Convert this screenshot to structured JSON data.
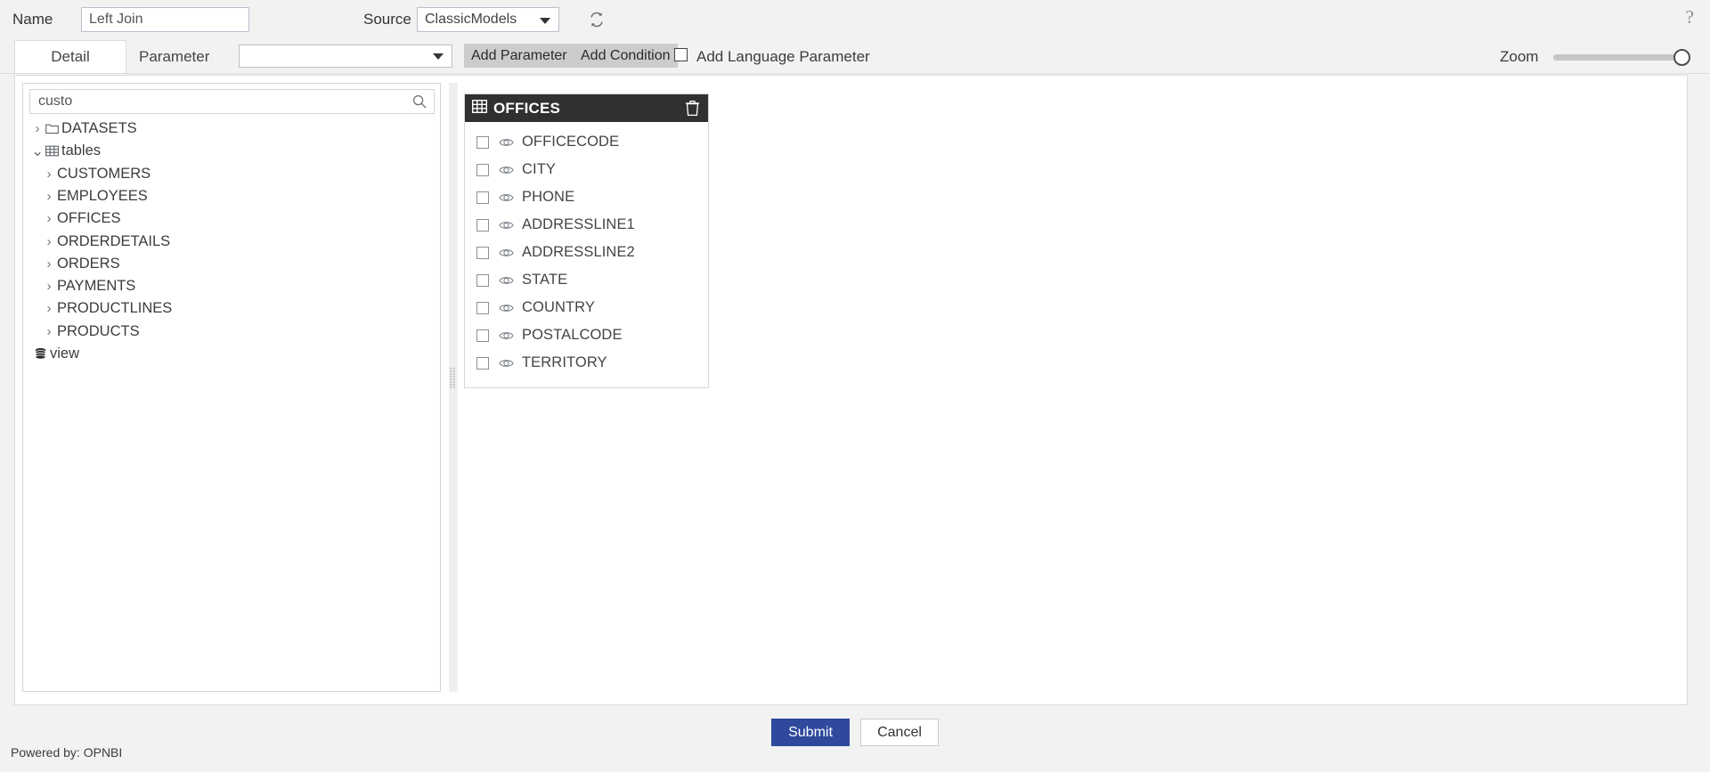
{
  "header": {
    "name_label": "Name",
    "name_value": "Left Join",
    "source_label": "Source",
    "source_value": "ClassicModels",
    "refresh_icon": "refresh-icon",
    "help_icon": "help-icon"
  },
  "toolbar": {
    "tab_detail": "Detail",
    "parameter_label": "Parameter",
    "parameter_value": "",
    "add_parameter": "Add Parameter",
    "add_condition": "Add Condition",
    "add_language_parameter": "Add Language Parameter",
    "language_checked": false,
    "zoom_label": "Zoom",
    "zoom_value": 100
  },
  "tree": {
    "search_value": "custo",
    "search_placeholder": "",
    "search_icon": "search-icon",
    "nodes": [
      {
        "label": "DATASETS",
        "depth": 0,
        "chevron": "right",
        "icon": "folder-icon"
      },
      {
        "label": "tables",
        "depth": 0,
        "chevron": "down",
        "icon": "table-grid-icon"
      },
      {
        "label": "CUSTOMERS",
        "depth": 1,
        "chevron": "right",
        "icon": "none"
      },
      {
        "label": "EMPLOYEES",
        "depth": 1,
        "chevron": "right",
        "icon": "none"
      },
      {
        "label": "OFFICES",
        "depth": 1,
        "chevron": "right",
        "icon": "none"
      },
      {
        "label": "ORDERDETAILS",
        "depth": 1,
        "chevron": "right",
        "icon": "none"
      },
      {
        "label": "ORDERS",
        "depth": 1,
        "chevron": "right",
        "icon": "none"
      },
      {
        "label": "PAYMENTS",
        "depth": 1,
        "chevron": "right",
        "icon": "none"
      },
      {
        "label": "PRODUCTLINES",
        "depth": 1,
        "chevron": "right",
        "icon": "none"
      },
      {
        "label": "PRODUCTS",
        "depth": 1,
        "chevron": "right",
        "icon": "none"
      },
      {
        "label": "view",
        "depth": 0,
        "chevron": "none",
        "icon": "database-icon"
      }
    ]
  },
  "canvas": {
    "table_card": {
      "title": "OFFICES",
      "title_icon": "table-grid-icon",
      "delete_icon": "trash-icon",
      "fields": [
        {
          "name": "OFFICECODE",
          "checked": false,
          "visible": true
        },
        {
          "name": "CITY",
          "checked": false,
          "visible": true
        },
        {
          "name": "PHONE",
          "checked": false,
          "visible": true
        },
        {
          "name": "ADDRESSLINE1",
          "checked": false,
          "visible": true
        },
        {
          "name": "ADDRESSLINE2",
          "checked": false,
          "visible": true
        },
        {
          "name": "STATE",
          "checked": false,
          "visible": true
        },
        {
          "name": "COUNTRY",
          "checked": false,
          "visible": true
        },
        {
          "name": "POSTALCODE",
          "checked": false,
          "visible": true
        },
        {
          "name": "TERRITORY",
          "checked": false,
          "visible": true
        }
      ]
    }
  },
  "footer": {
    "submit": "Submit",
    "cancel": "Cancel",
    "powered_by": "Powered by: OPNBI"
  },
  "colors": {
    "accent": "#2f4a9c",
    "card_header": "#303030",
    "page_bg": "#f2f2f2",
    "button_gray": "#cccccc"
  }
}
